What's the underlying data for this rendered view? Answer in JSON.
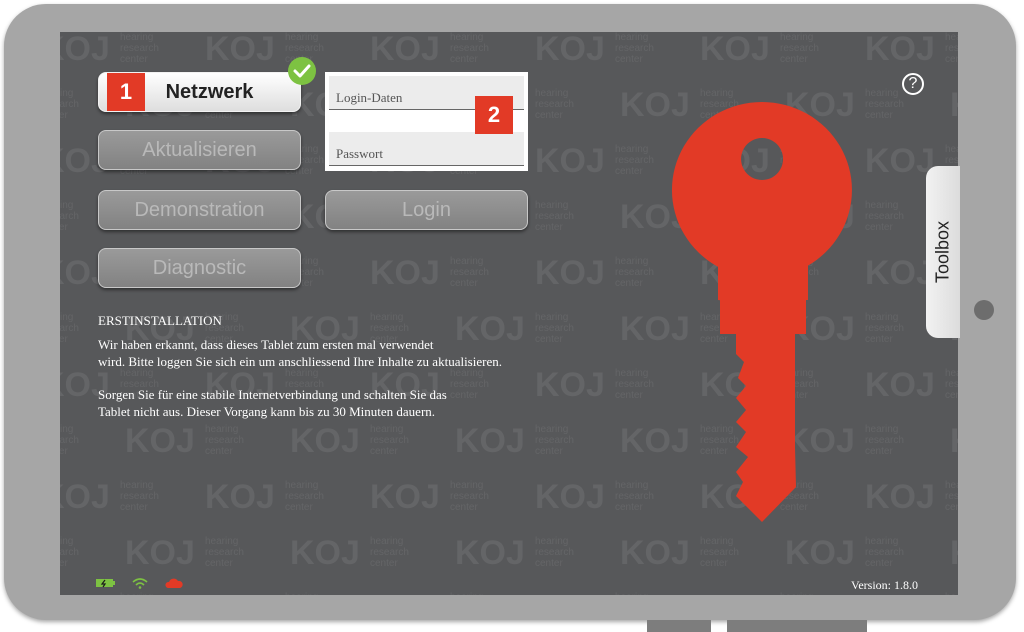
{
  "sidebar": {
    "buttons": [
      {
        "label": "Netzwerk",
        "marker": "1",
        "active": true
      },
      {
        "label": "Aktualisieren"
      },
      {
        "label": "Demonstration"
      },
      {
        "label": "Diagnostic"
      }
    ]
  },
  "login": {
    "username_placeholder": "Login-Daten",
    "password_placeholder": "Passwort",
    "marker": "2",
    "button_label": "Login"
  },
  "help_label": "?",
  "toolbox_label": "Toolbox",
  "info": {
    "heading": "ERSTINSTALLATION",
    "para1_line1": "Wir haben erkannt, dass dieses Tablet zum ersten mal verwendet",
    "para1_line2": "wird. Bitte loggen Sie sich ein um anschliessend Ihre Inhalte zu aktualisieren.",
    "para2_line1": "Sorgen Sie für eine stabile Internetverbindung und schalten Sie das",
    "para2_line2": "Tablet nicht aus. Dieser Vorgang kann bis zu 30 Minuten dauern."
  },
  "version": "Version: 1.8.0",
  "status_icons": [
    "battery-charging-icon",
    "wifi-icon",
    "cloud-icon"
  ],
  "watermark": {
    "logo": "KOJ",
    "tagline": "hearing research center"
  },
  "colors": {
    "accent": "#e23a26",
    "check": "#7dc242",
    "screen": "#57585a"
  }
}
